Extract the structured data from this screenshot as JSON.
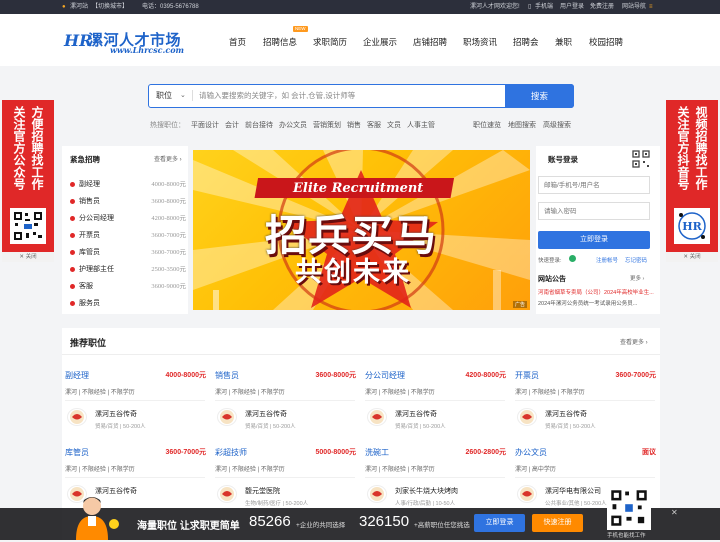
{
  "topbar": {
    "city": "漯河站",
    "switch_city": "【切换城市】",
    "phone": "电话：0395-5676788",
    "welcome": "漯河人才网欢迎您!",
    "mobile": "手机端",
    "login": "用户登录",
    "register": "免费注册",
    "site_nav": "网站导航"
  },
  "logo": {
    "mark": "HR",
    "title": "漯河人才市场",
    "url": "www.Lhrcsc.com"
  },
  "nav": {
    "items": [
      "首页",
      "招聘信息",
      "求职简历",
      "企业展示",
      "店铺招聘",
      "职场资讯",
      "招聘会",
      "兼职",
      "校园招聘"
    ],
    "badge": "NEW"
  },
  "search": {
    "category": "职位",
    "placeholder": "请输入要搜索的关键字，如 会计,仓管,设计师等",
    "button": "搜索"
  },
  "hot": {
    "label": "热搜职位：",
    "keywords": [
      "平面设计",
      "会计",
      "前台接待",
      "办公文员",
      "营销策划",
      "销售",
      "客服",
      "文员",
      "人事主管"
    ],
    "links": [
      "职位速览",
      "地图搜索",
      "高级搜索"
    ]
  },
  "side_ads": {
    "left": {
      "col1": "关注官方公众号",
      "col2": "方便招聘找工作",
      "close": "关闭"
    },
    "right": {
      "col1": "关注官方抖音号",
      "col2": "视频招聘找工作",
      "close": "关闭"
    }
  },
  "urgent": {
    "title": "紧急招聘",
    "more": "查看更多",
    "items": [
      {
        "name": "副经理",
        "salary": "4000-8000元"
      },
      {
        "name": "销售员",
        "salary": "3600-8000元"
      },
      {
        "name": "分公司经理",
        "salary": "4200-8000元"
      },
      {
        "name": "开票员",
        "salary": "3600-7000元"
      },
      {
        "name": "库管员",
        "salary": "3600-7000元"
      },
      {
        "name": "护理部主任",
        "salary": "2500-3500元"
      },
      {
        "name": "客服",
        "salary": "3600-9000元"
      },
      {
        "name": "服务员",
        "salary": ""
      }
    ]
  },
  "banner": {
    "en": "Elite Recruitment",
    "line1": "招兵买马",
    "line2": "共创未来",
    "tag": "广告"
  },
  "account": {
    "title": "账号登录",
    "user_placeholder": "邮箱/手机号/用户名",
    "pass_placeholder": "请输入密码",
    "login_btn": "立即登录",
    "quick_login": "快速登录:",
    "register": "注册帐号",
    "forgot": "忘记密码"
  },
  "notice": {
    "title": "网站公告",
    "more": "更多",
    "items": [
      "河南省烟草专卖局（公司）2024年高校毕业生...",
      "2024年漯河公务员统一考试录用公务员..."
    ]
  },
  "recommended": {
    "title": "推荐职位",
    "more": "查看更多",
    "jobs": [
      {
        "title": "副经理",
        "salary": "4000-8000元",
        "meta": "漯河 | 不限经验 | 不限学历",
        "company": "漯河五谷传奇",
        "info": "贸易/百货 | 50-200人"
      },
      {
        "title": "销售员",
        "salary": "3600-8000元",
        "meta": "漯河 | 不限经验 | 不限学历",
        "company": "漯河五谷传奇",
        "info": "贸易/百货 | 50-200人"
      },
      {
        "title": "分公司经理",
        "salary": "4200-8000元",
        "meta": "漯河 | 不限经验 | 不限学历",
        "company": "漯河五谷传奇",
        "info": "贸易/百货 | 50-200人"
      },
      {
        "title": "开票员",
        "salary": "3600-7000元",
        "meta": "漯河 | 不限经验 | 不限学历",
        "company": "漯河五谷传奇",
        "info": "贸易/百货 | 50-200人"
      },
      {
        "title": "库管员",
        "salary": "3600-7000元",
        "meta": "漯河 | 不限经验 | 不限学历",
        "company": "漯河五谷传奇",
        "info": ""
      },
      {
        "title": "彩超技师",
        "salary": "5000-8000元",
        "meta": "漯河 | 不限经验 | 不限学历",
        "company": "馥元堂医院",
        "info": "生物/制药/医疗 | 50-200人"
      },
      {
        "title": "洗碗工",
        "salary": "2600-2800元",
        "meta": "漯河 | 不限经验 | 不限学历",
        "company": "刘家长牛烧大块烤肉",
        "info": "人事/行政/后勤 | 10-50人"
      },
      {
        "title": "办公文员",
        "salary": "面议",
        "meta": "漯河 | 高中学历",
        "company": "漯河华电有限公司",
        "info": "公共事业/其他 | 50-200人"
      }
    ]
  },
  "bottom_bar": {
    "slogan": "海量职位 让求职更简单",
    "count1": "85266",
    "count1_label": "+企业的共同选择",
    "count2": "326150",
    "count2_label": "+高薪职位任您挑选",
    "login_btn": "立即登录",
    "register_btn": "快速注册",
    "qr_caption": "手机也能找工作"
  },
  "colors": {
    "brand_blue": "#2f73e0",
    "accent_red": "#e02828",
    "accent_orange": "#ff8a00"
  }
}
